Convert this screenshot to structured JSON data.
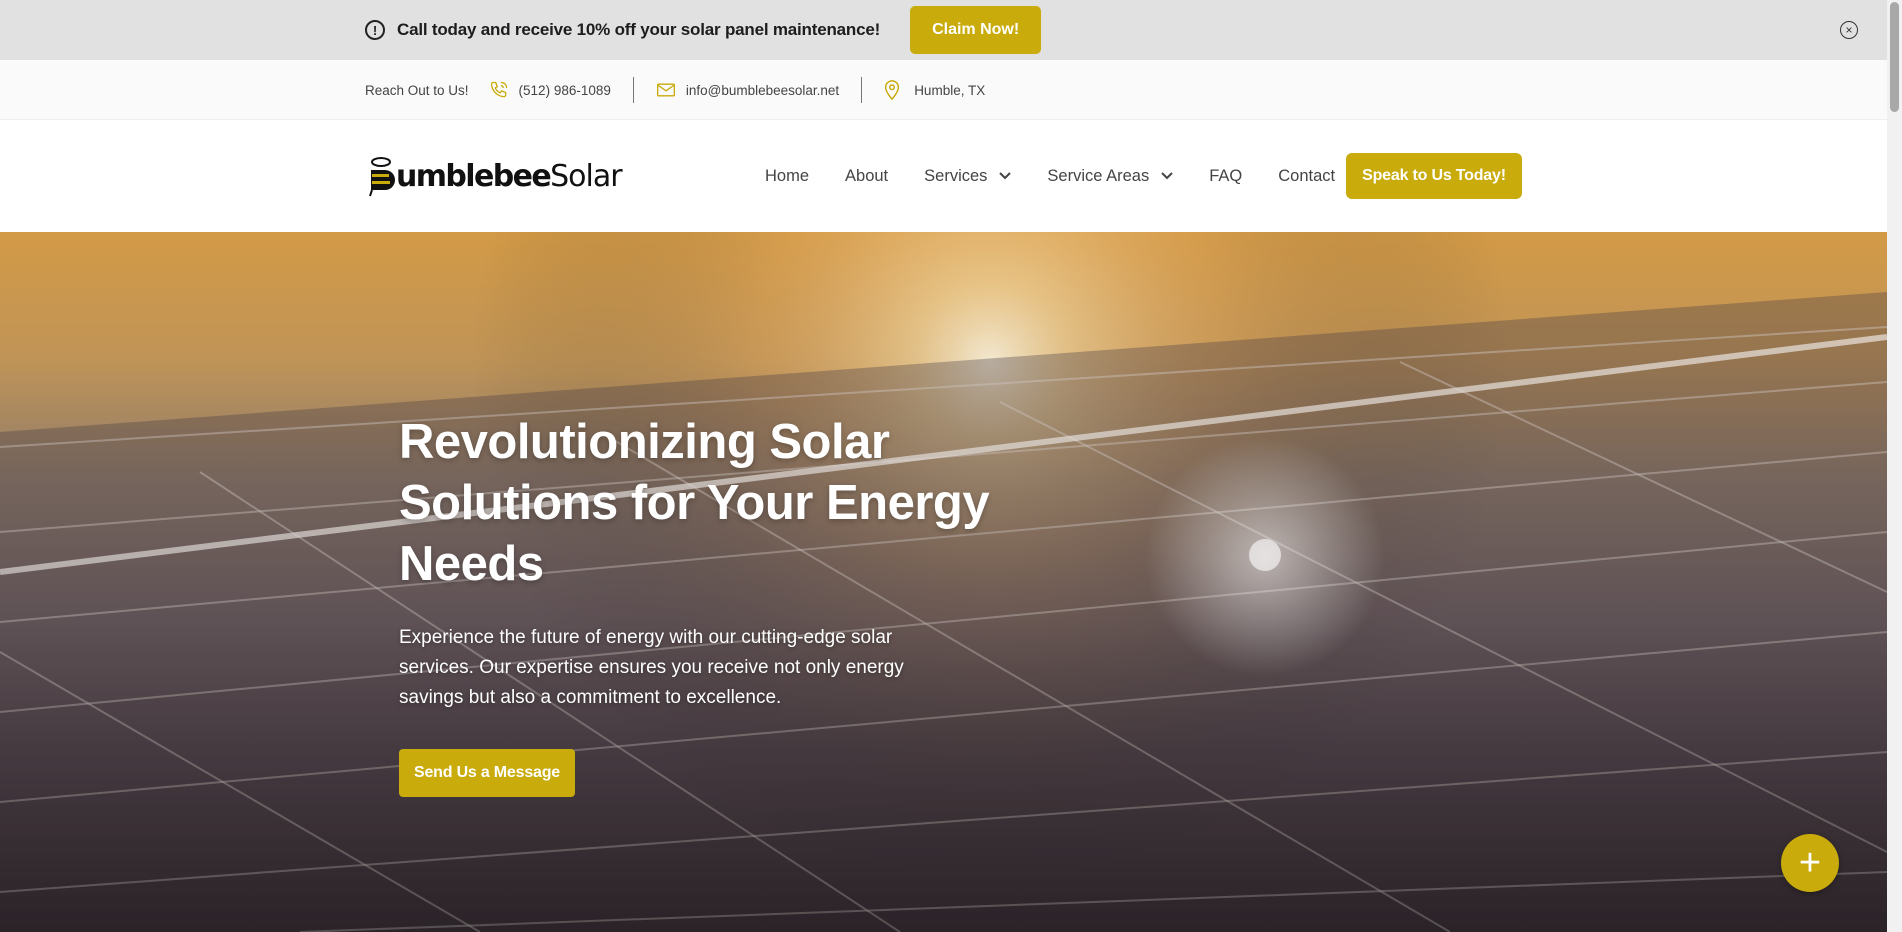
{
  "announcement": {
    "message": "Call today and receive 10% off your solar panel maintenance!",
    "cta_label": "Claim Now!",
    "alert_icon": "!",
    "close_icon": "×"
  },
  "topbar": {
    "reach_label": "Reach Out to Us!",
    "phone": "(512) 986-1089",
    "email": "info@bumblebeesolar.net",
    "location": "Humble, TX"
  },
  "header": {
    "logo_bold": "umblebee",
    "logo_regular": "Solar",
    "nav": {
      "home": "Home",
      "about": "About",
      "services": "Services",
      "service_areas": "Service Areas",
      "faq": "FAQ",
      "contact": "Contact"
    },
    "cta_label": "Speak to Us Today!"
  },
  "hero": {
    "title": "Revolutionizing Solar Solutions for Your Energy Needs",
    "text": "Experience the future of energy with our cutting-edge solar services. Our expertise ensures you receive not only energy savings but also a commitment to excellence.",
    "cta_label": "Send Us a Message"
  },
  "fab_icon": "+",
  "colors": {
    "accent": "#c9ab0c",
    "announce_bg": "#e1e1e1",
    "topbar_bg": "#fafafa"
  }
}
